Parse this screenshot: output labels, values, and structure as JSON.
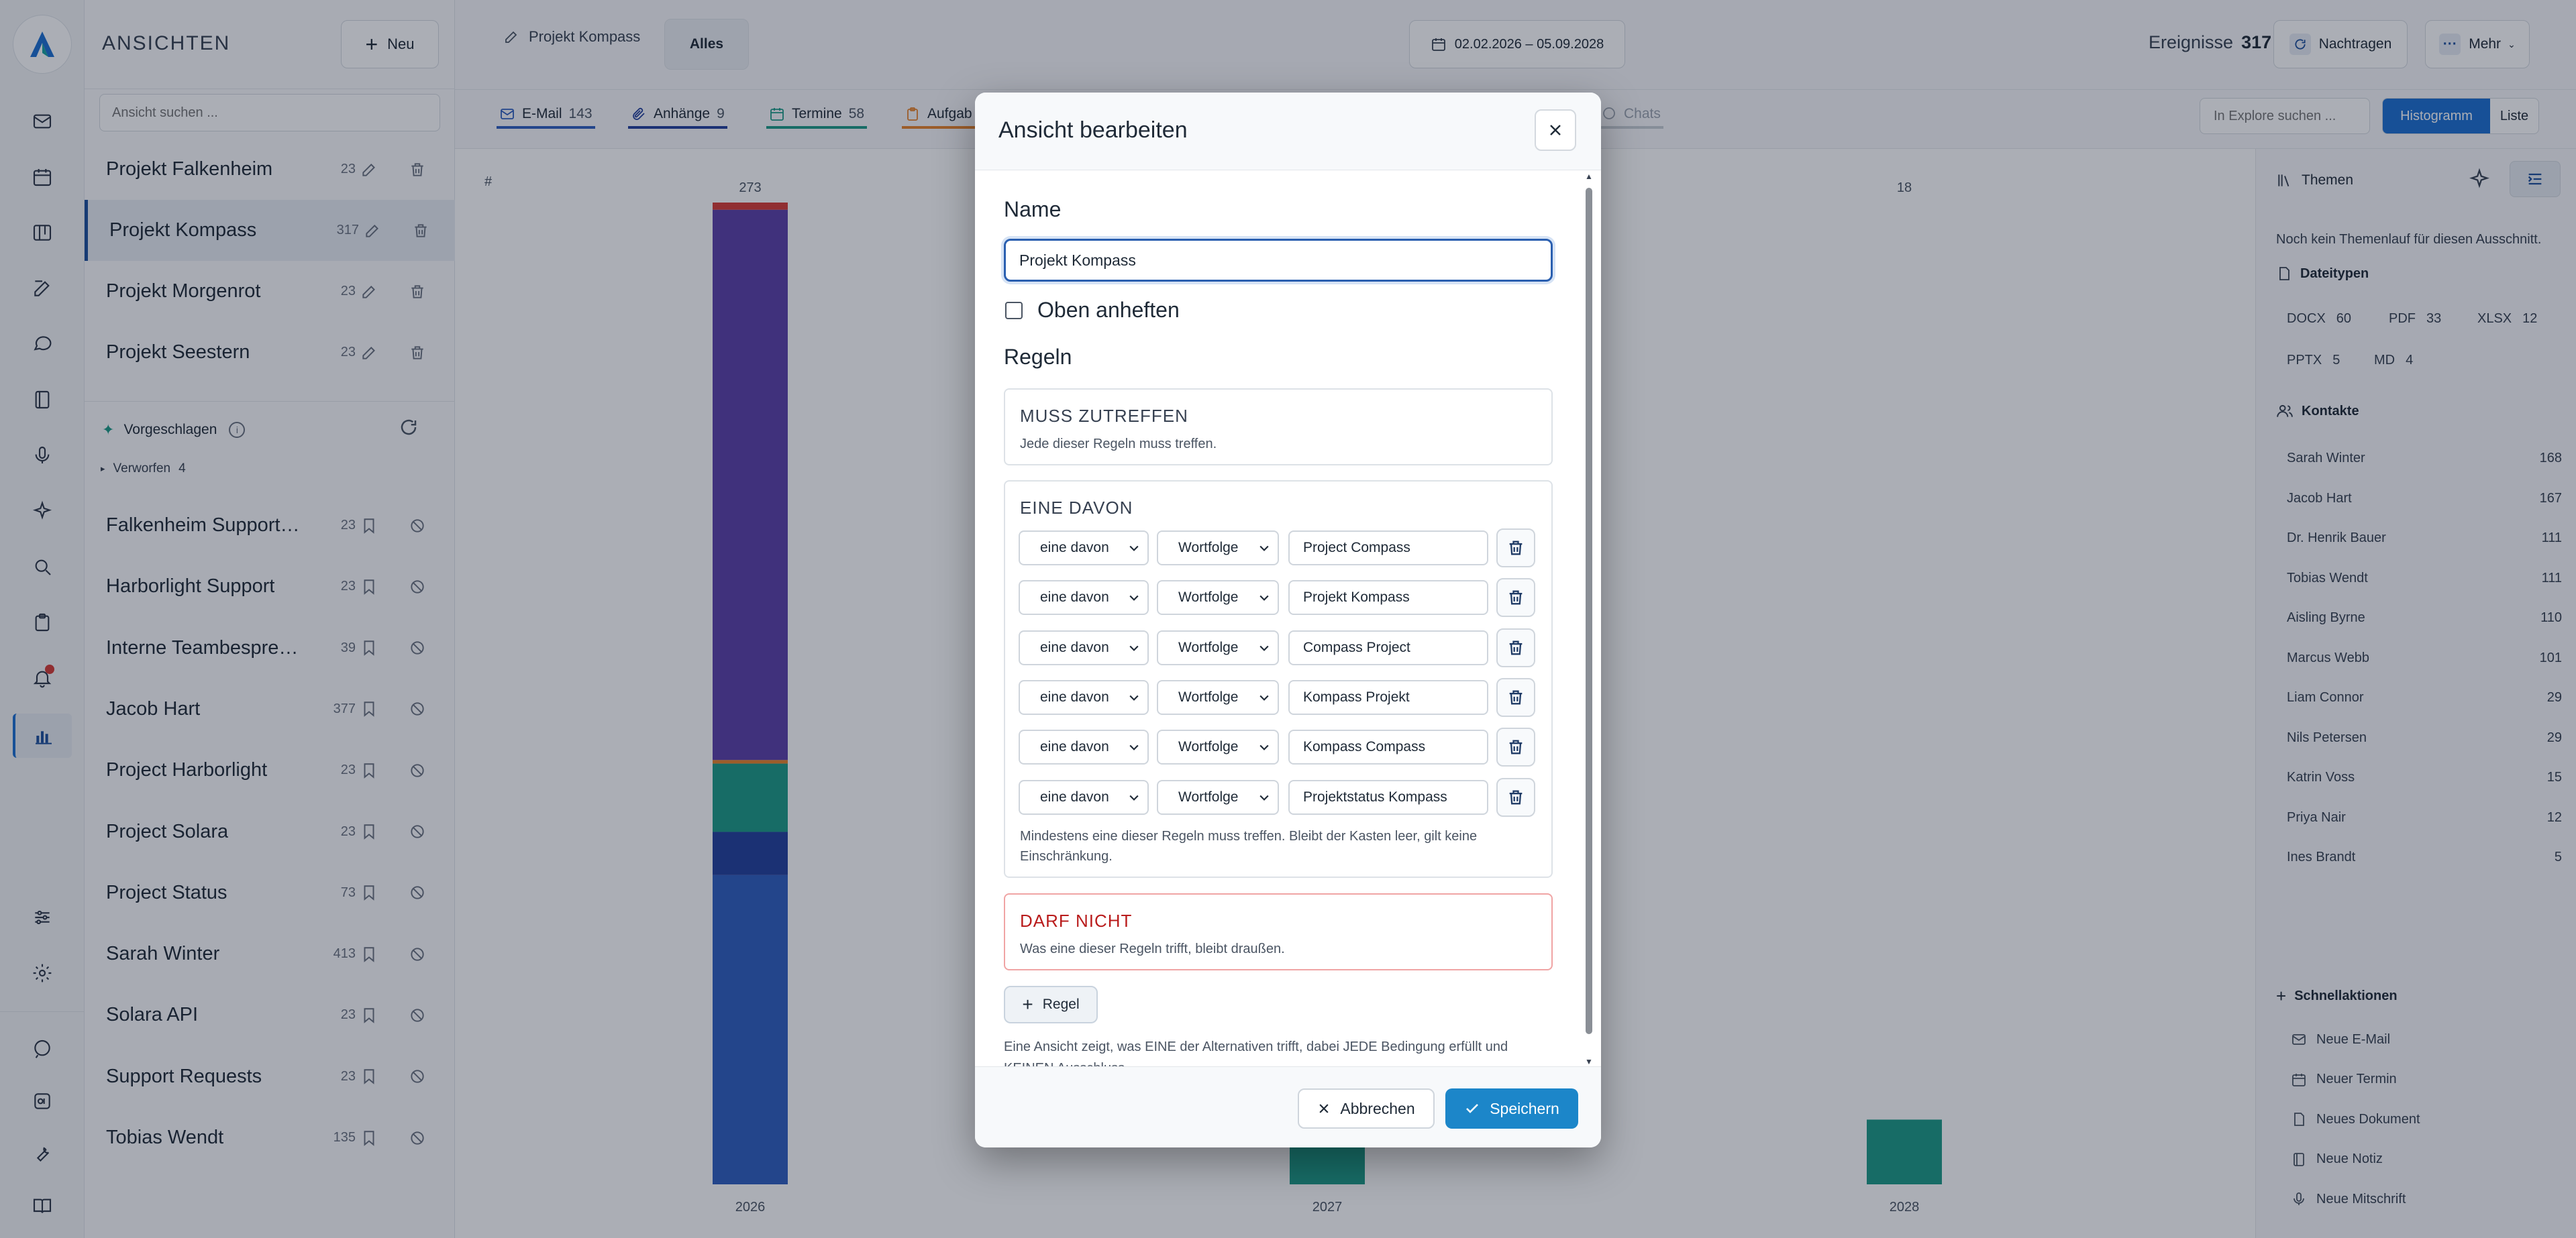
{
  "sidebar": {
    "title": "ANSICHTEN",
    "new_button": "Neu",
    "search_placeholder": "Ansicht suchen ...",
    "views": [
      {
        "name": "Projekt Falkenheim",
        "count": "23"
      },
      {
        "name": "Projekt Kompass",
        "count": "317"
      },
      {
        "name": "Projekt Morgenrot",
        "count": "23"
      },
      {
        "name": "Projekt Seestern",
        "count": "23"
      }
    ],
    "suggested_label": "Vorgeschlagen",
    "discarded_label": "Verworfen",
    "discarded_count": "4",
    "suggestions": [
      {
        "name": "Falkenheim Supportanf...",
        "count": "23"
      },
      {
        "name": "Harborlight Support",
        "count": "23"
      },
      {
        "name": "Interne Teambesprechu...",
        "count": "39"
      },
      {
        "name": "Jacob Hart",
        "count": "377"
      },
      {
        "name": "Project Harborlight",
        "count": "23"
      },
      {
        "name": "Project Solara",
        "count": "23"
      },
      {
        "name": "Project Status",
        "count": "73"
      },
      {
        "name": "Sarah Winter",
        "count": "413"
      },
      {
        "name": "Solara API",
        "count": "23"
      },
      {
        "name": "Support Requests",
        "count": "23"
      },
      {
        "name": "Tobias Wendt",
        "count": "135"
      }
    ]
  },
  "header": {
    "tab_project": "Projekt Kompass",
    "tab_all": "Alles",
    "date_range": "02.02.2026 – 05.09.2028",
    "events_label": "Ereignisse",
    "events_count": "317",
    "reload_label": "Nachtragen",
    "more_label": "Mehr"
  },
  "filters": {
    "email_label": "E-Mail",
    "email_count": "143",
    "attach_label": "Anhänge",
    "attach_count": "9",
    "dates_label": "Termine",
    "dates_count": "58",
    "tasks_label": "Aufgab",
    "chats_label": "Chats",
    "explore_placeholder": "In Explore suchen ...",
    "histogram_label": "Histogramm",
    "list_label": "Liste"
  },
  "chart": {
    "hash_label": "#",
    "colors": {
      "purple": "#5b3fa8",
      "teal": "#1c9a86",
      "navy": "#233f9c",
      "blue": "#2f5fbf",
      "red": "#d63b35",
      "orange": "#e8832a"
    }
  },
  "chart_data": {
    "type": "bar",
    "categories": [
      "2026",
      "2027",
      "2028"
    ],
    "values": [
      273,
      26,
      18
    ],
    "data_labels": [
      "273",
      "",
      "18"
    ],
    "ylim": [
      0,
      273
    ],
    "stack_2026": {
      "purple": 153,
      "teal": 19,
      "navy": 12,
      "blue": 86,
      "orange": 1,
      "red": 2
    }
  },
  "right_panel": {
    "themes_label": "Themen",
    "themes_empty": "Noch kein Themenlauf für diesen Ausschnitt.",
    "filetypes_label": "Dateitypen",
    "filetypes": [
      {
        "name": "DOCX",
        "count": "60"
      },
      {
        "name": "PDF",
        "count": "33"
      },
      {
        "name": "XLSX",
        "count": "12"
      },
      {
        "name": "PPTX",
        "count": "5"
      },
      {
        "name": "MD",
        "count": "4"
      }
    ],
    "contacts_label": "Kontakte",
    "contacts": [
      {
        "name": "Sarah Winter",
        "count": "168"
      },
      {
        "name": "Jacob Hart",
        "count": "167"
      },
      {
        "name": "Dr. Henrik Bauer",
        "count": "111"
      },
      {
        "name": "Tobias Wendt",
        "count": "111"
      },
      {
        "name": "Aisling Byrne",
        "count": "110"
      },
      {
        "name": "Marcus Webb",
        "count": "101"
      },
      {
        "name": "Liam Connor",
        "count": "29"
      },
      {
        "name": "Nils Petersen",
        "count": "29"
      },
      {
        "name": "Katrin Voss",
        "count": "15"
      },
      {
        "name": "Priya Nair",
        "count": "12"
      },
      {
        "name": "Ines Brandt",
        "count": "5"
      }
    ],
    "quick_label": "Schnellaktionen",
    "quick_actions": [
      "Neue E-Mail",
      "Neuer Termin",
      "Neues Dokument",
      "Neue Notiz",
      "Neue Mitschrift"
    ]
  },
  "modal": {
    "title": "Ansicht bearbeiten",
    "name_label": "Name",
    "name_value": "Projekt Kompass",
    "pin_label": "Oben anheften",
    "rules_label": "Regeln",
    "must_title": "MUSS ZUTREFFEN",
    "must_desc": "Jede dieser Regeln muss treffen.",
    "any_title": "EINE DAVON",
    "any_rules": [
      {
        "mode": "eine davon",
        "type": "Wortfolge",
        "value": "Project Compass"
      },
      {
        "mode": "eine davon",
        "type": "Wortfolge",
        "value": "Projekt Kompass"
      },
      {
        "mode": "eine davon",
        "type": "Wortfolge",
        "value": "Compass Project"
      },
      {
        "mode": "eine davon",
        "type": "Wortfolge",
        "value": "Kompass Projekt"
      },
      {
        "mode": "eine davon",
        "type": "Wortfolge",
        "value": "Kompass Compass"
      },
      {
        "mode": "eine davon",
        "type": "Wortfolge",
        "value": "Projektstatus Kompass"
      }
    ],
    "any_desc_1": "Mindestens eine dieser Regeln muss treffen. Bleibt der Kasten leer, gilt keine",
    "any_desc_2": "Einschränkung.",
    "not_title": "DARF NICHT",
    "not_desc": "Was eine dieser Regeln trifft, bleibt draußen.",
    "add_rule": "Regel",
    "footnote_1": "Eine Ansicht zeigt, was EINE der Alternativen trifft, dabei JEDE Bedingung erfüllt und",
    "footnote_2": "KEINEN Ausschluss.",
    "cancel": "Abbrechen",
    "save": "Speichern"
  }
}
